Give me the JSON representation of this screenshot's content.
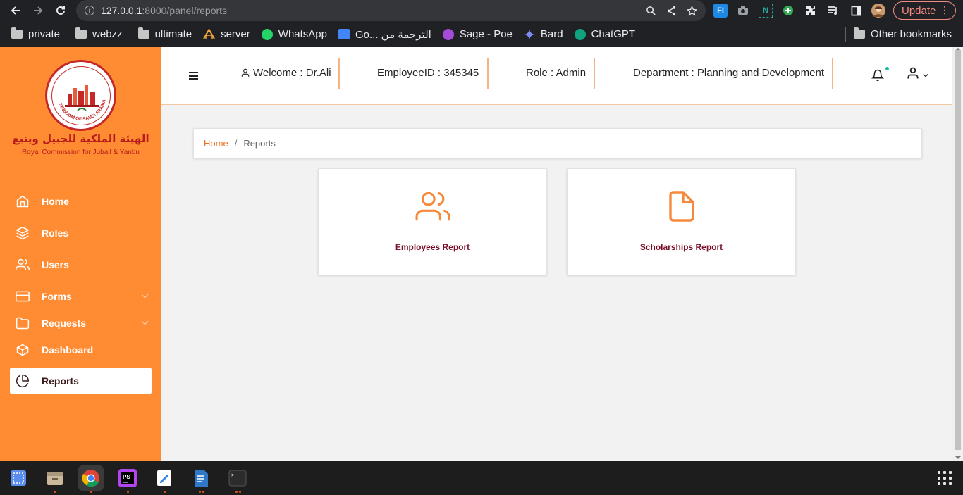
{
  "browser": {
    "url_host": "127.0.0.1",
    "url_path": ":8000/panel/reports",
    "update_label": "Update",
    "bookmarks": [
      {
        "label": "private",
        "icon": "folder-icon"
      },
      {
        "label": "webzz",
        "icon": "folder-icon"
      },
      {
        "label": "ultimate",
        "icon": "folder-icon"
      },
      {
        "label": "server",
        "icon": "server-favicon"
      },
      {
        "label": "WhatsApp",
        "icon": "whatsapp-icon"
      },
      {
        "label": "Go... الترجمة من",
        "icon": "google-translate-icon"
      },
      {
        "label": "Sage - Poe",
        "icon": "poe-icon"
      },
      {
        "label": "Bard",
        "icon": "bard-icon"
      },
      {
        "label": "ChatGPT",
        "icon": "chatgpt-icon"
      }
    ],
    "other_bookmarks": "Other bookmarks"
  },
  "sidebar": {
    "brand_ar": "الهيئة الملكية للجبيل وينبع",
    "brand_en": "Royal Commission for Jubail & Yanbu",
    "logo_text": "KINGDOM OF SAUDI ARABIA",
    "items": [
      {
        "label": "Home",
        "icon": "home-icon"
      },
      {
        "label": "Roles",
        "icon": "layers-icon"
      },
      {
        "label": "Users",
        "icon": "users-icon"
      },
      {
        "label": "Forms",
        "icon": "credit-card-icon"
      },
      {
        "label": "Requests",
        "icon": "folder-icon"
      },
      {
        "label": "Dashboard",
        "icon": "package-icon"
      },
      {
        "label": "Reports",
        "icon": "pie-chart-icon"
      }
    ]
  },
  "header": {
    "welcome": "Welcome : Dr.Ali",
    "employee_id": "EmployeeID : 345345",
    "role": "Role : Admin",
    "department": "Department : Planning and Development"
  },
  "breadcrumb": {
    "home": "Home",
    "separator": "/",
    "current": "Reports"
  },
  "cards": [
    {
      "title": "Employees Report",
      "icon": "users-icon"
    },
    {
      "title": "Scholarships Report",
      "icon": "file-icon"
    }
  ],
  "colors": {
    "sidebar": "#ff8c33",
    "accent": "#e86e1c",
    "card_title": "#7b0f2a"
  }
}
